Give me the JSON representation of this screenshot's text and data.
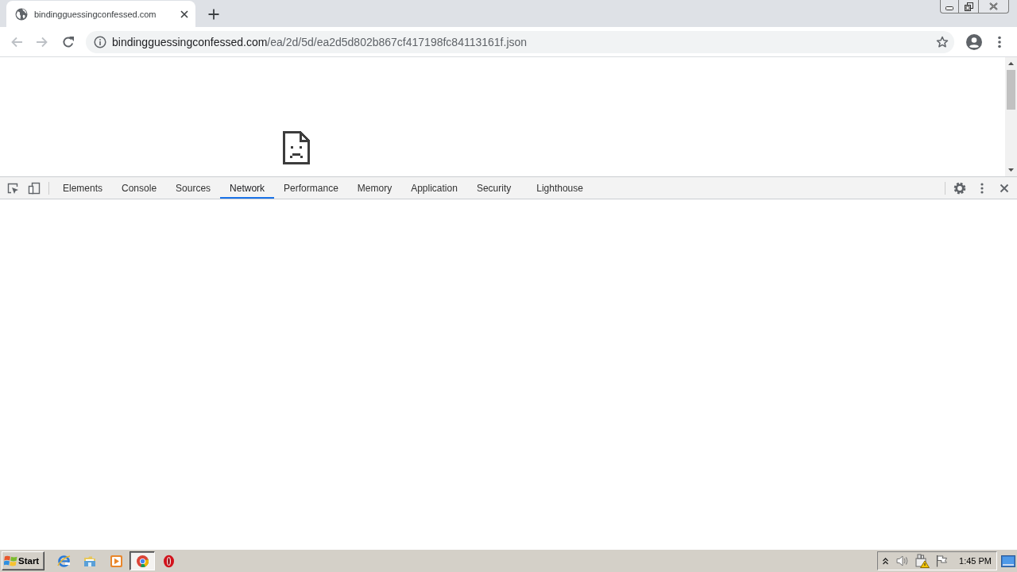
{
  "browser": {
    "tabs": [
      {
        "title": "bindingguessingconfessed.com",
        "selected": true
      }
    ],
    "address_bar": {
      "host": "bindingguessingconfessed.com",
      "path": "/ea/2d/5d/ea2d5d802b867cf417198fc84113161f.json"
    }
  },
  "devtools": {
    "tabs": [
      {
        "label": "Elements",
        "selected": false
      },
      {
        "label": "Console",
        "selected": false
      },
      {
        "label": "Sources",
        "selected": false
      },
      {
        "label": "Network",
        "selected": true
      },
      {
        "label": "Performance",
        "selected": false
      },
      {
        "label": "Memory",
        "selected": false
      },
      {
        "label": "Application",
        "selected": false
      },
      {
        "label": "Security",
        "selected": false
      },
      {
        "label": "Lighthouse",
        "selected": false
      }
    ]
  },
  "taskbar": {
    "start": "Start",
    "apps": [
      {
        "kind": "letter_e",
        "selected": false
      },
      {
        "kind": "folder",
        "selected": false
      },
      {
        "kind": "play",
        "selected": false
      },
      {
        "kind": "circle_logo",
        "selected": true
      },
      {
        "kind": "o_ring",
        "selected": false
      }
    ],
    "clock": "1:45 PM"
  }
}
